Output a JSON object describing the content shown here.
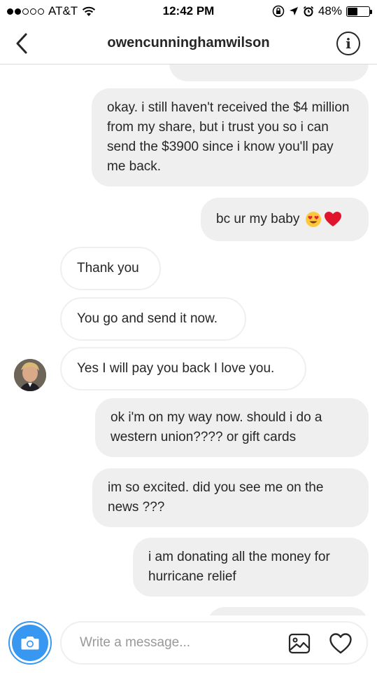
{
  "status_bar": {
    "carrier": "AT&T",
    "time": "12:42 PM",
    "battery_percent": "48%",
    "battery_level": 0.48
  },
  "header": {
    "title": "owencunninghamwilson"
  },
  "messages": [
    {
      "id": "m1",
      "from": "me",
      "text": "okay.  i still haven't received the $4 million from my share, but i trust you so i can send the $3900 since i know you'll pay me back."
    },
    {
      "id": "m2",
      "from": "me",
      "text": "bc ur my baby",
      "emoji": [
        "heart-eyes-emoji",
        "red-heart-emoji"
      ]
    },
    {
      "id": "m3",
      "from": "them",
      "text": "Thank you"
    },
    {
      "id": "m4",
      "from": "them",
      "text": "You go and send it now."
    },
    {
      "id": "m5",
      "from": "them",
      "text": "Yes I will pay you back I love you."
    },
    {
      "id": "m6",
      "from": "me",
      "text": "ok i'm on my way now.   should i do a western union???? or gift cards"
    },
    {
      "id": "m7",
      "from": "me",
      "text": "im so excited.  did you see me on the news ???"
    },
    {
      "id": "m8",
      "from": "me",
      "text": "i am donating all the money for hurricane relief"
    }
  ],
  "composer": {
    "placeholder": "Write a message...",
    "camera_icon": "camera-icon",
    "gallery_icon": "gallery-icon",
    "heart_icon": "heart-icon",
    "accent_color": "#3897f0"
  },
  "colors": {
    "outgoing_bubble": "#efefef",
    "incoming_border": "#efefef",
    "text": "#262626"
  }
}
